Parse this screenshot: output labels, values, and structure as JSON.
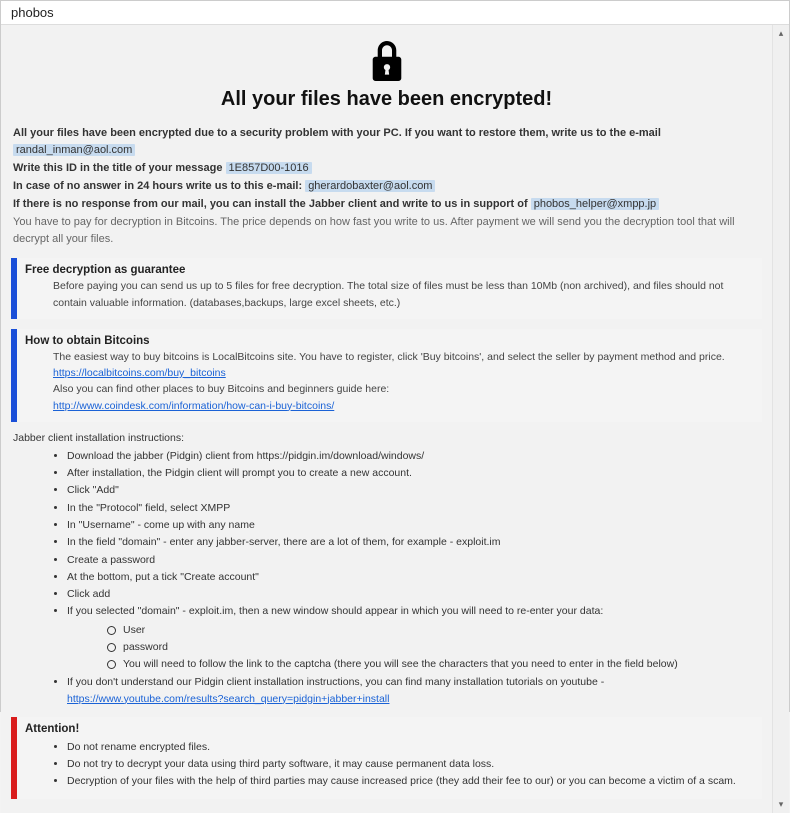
{
  "window": {
    "title": "phobos"
  },
  "hero": {
    "heading": "All your files have been encrypted!"
  },
  "intro": {
    "line1_prefix": "All your files have been encrypted due to a security problem with your PC. If you want to restore them, write us to the e-mail ",
    "email1": "randal_inman@aol.com",
    "line2_prefix": "Write this ID in the title of your message ",
    "id": "1E857D00-1016",
    "line3_prefix": "In case of no answer in 24 hours write us to this e-mail: ",
    "email2": "gherardobaxter@aol.com",
    "line4_prefix": "If there is no response from our mail, you can install the Jabber client and write to us in support of ",
    "jabber": "phobos_helper@xmpp.jp",
    "line5": "You have to pay for decryption in Bitcoins. The price depends on how fast you write to us. After payment we will send you the decryption tool that will decrypt all your files."
  },
  "free_decrypt": {
    "title": "Free decryption as guarantee",
    "body": "Before paying you can send us up to 5 files for free decryption. The total size of files must be less than 10Mb (non archived), and files should not contain valuable information. (databases,backups, large excel sheets, etc.)"
  },
  "bitcoins": {
    "title": "How to obtain Bitcoins",
    "line1": "The easiest way to buy bitcoins is LocalBitcoins site. You have to register, click 'Buy bitcoins', and select the seller by payment method and price.",
    "link1": "https://localbitcoins.com/buy_bitcoins",
    "line2": "Also you can find other places to buy Bitcoins and beginners guide here:",
    "link2": "http://www.coindesk.com/information/how-can-i-buy-bitcoins/"
  },
  "jabber_instr": {
    "title": "Jabber client installation instructions:",
    "items": [
      "Download the jabber (Pidgin) client from https://pidgin.im/download/windows/",
      "After installation, the Pidgin client will prompt you to create a new account.",
      "Click \"Add\"",
      "In the \"Protocol\" field, select XMPP",
      "In \"Username\" - come up with any name",
      "In the field \"domain\" - enter any jabber-server, there are a lot of them, for example - exploit.im",
      "Create a password",
      "At the bottom, put a tick \"Create account\"",
      "Click add",
      "If you selected \"domain\" - exploit.im, then a new window should appear in which you will need to re-enter your data:"
    ],
    "sub": [
      "User",
      "password",
      "You will need to follow the link to the captcha (there you will see the characters that you need to enter in the field below)"
    ],
    "last_prefix": "If you don't understand our Pidgin client installation instructions, you can find many installation tutorials on youtube - ",
    "last_link": "https://www.youtube.com/results?search_query=pidgin+jabber+install"
  },
  "attention": {
    "title": "Attention!",
    "items": [
      "Do not rename encrypted files.",
      "Do not try to decrypt your data using third party software, it may cause permanent data loss.",
      "Decryption of your files with the help of third parties may cause increased price (they add their fee to our) or you can become a victim of a scam."
    ]
  }
}
